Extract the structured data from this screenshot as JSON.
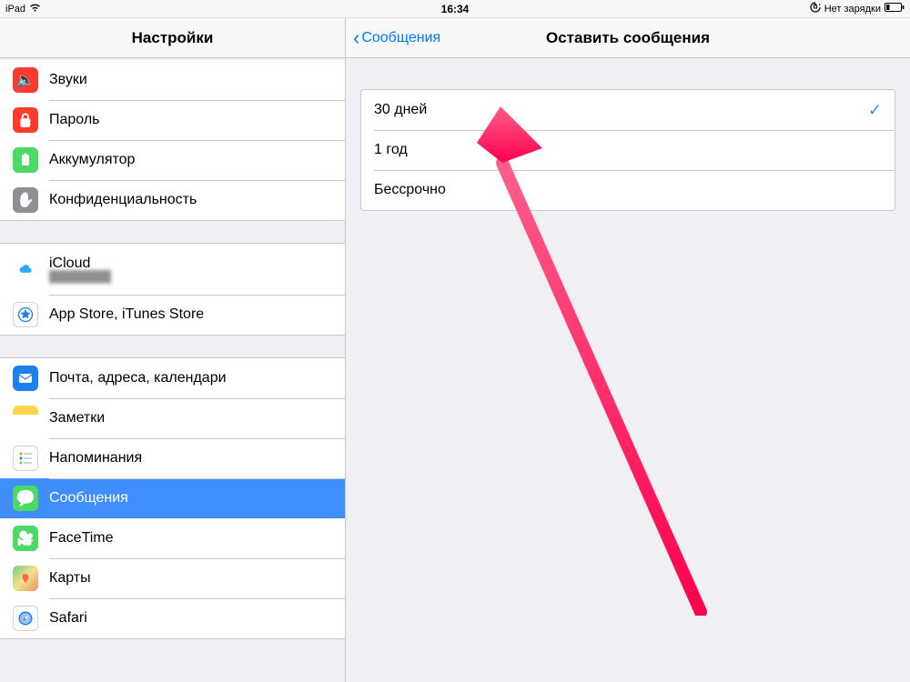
{
  "status": {
    "device": "iPad",
    "time": "16:34",
    "charge": "Нет зарядки"
  },
  "sidebar": {
    "title": "Настройки",
    "groups": [
      {
        "items": [
          {
            "key": "sounds",
            "label": "Звуки"
          },
          {
            "key": "passcode",
            "label": "Пароль"
          },
          {
            "key": "battery",
            "label": "Аккумулятор"
          },
          {
            "key": "privacy",
            "label": "Конфиденциальность"
          }
        ]
      },
      {
        "items": [
          {
            "key": "icloud",
            "label": "iCloud",
            "sub": "████████"
          },
          {
            "key": "appstore",
            "label": "App Store, iTunes Store"
          }
        ]
      },
      {
        "items": [
          {
            "key": "mail",
            "label": "Почта, адреса, календари"
          },
          {
            "key": "notes",
            "label": "Заметки"
          },
          {
            "key": "reminders",
            "label": "Напоминания"
          },
          {
            "key": "messages",
            "label": "Сообщения",
            "selected": true
          },
          {
            "key": "facetime",
            "label": "FaceTime"
          },
          {
            "key": "maps",
            "label": "Карты"
          },
          {
            "key": "safari",
            "label": "Safari"
          }
        ]
      }
    ]
  },
  "detail": {
    "back": "Сообщения",
    "title": "Оставить сообщения",
    "options": [
      {
        "label": "30 дней",
        "selected": true
      },
      {
        "label": "1 год",
        "selected": false
      },
      {
        "label": "Бессрочно",
        "selected": false
      }
    ]
  }
}
